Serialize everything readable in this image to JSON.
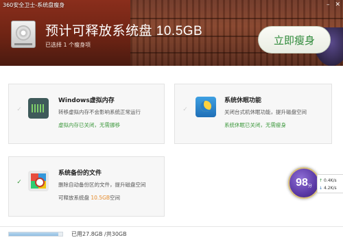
{
  "window": {
    "title": "360安全卫士-系统盘瘦身"
  },
  "header": {
    "headline": "预计可释放系统盘  10.5GB",
    "selected": "已选择 1 个瘦身项",
    "slim_button": "立即瘦身"
  },
  "cards": [
    {
      "title": "Windows虚拟内存",
      "desc": "转移虚拟内存不会影响系统正常运行",
      "status": "虚拟内存已关闭，无需挪移",
      "checked": false,
      "icon": "memory-icon"
    },
    {
      "title": "系统休眠功能",
      "desc": "关闭台式机休眠功能，提升磁盘空间",
      "status": "系统休眠已关闭，无需瘦身",
      "checked": false,
      "icon": "sleep-icon"
    },
    {
      "title": "系统备份的文件",
      "desc": "删除自动备份区的文件，提升磁盘空间",
      "status_prefix": "可释放系统盘 ",
      "status_value": "10.5GB",
      "status_suffix": "空间",
      "checked": true,
      "icon": "backup-icon"
    }
  ],
  "footer": {
    "usage": "已用27.8GB /共30GB",
    "used_fraction": 0.927
  },
  "widget": {
    "score": "98",
    "unit": "分",
    "upload": "0.4K/s",
    "download": "4.2K/s"
  },
  "colors": {
    "header_bg": "#7a2918",
    "accent_green": "#3f9a3f",
    "highlight_orange": "#e48a2a",
    "score_purple": "#5b3aa6"
  }
}
